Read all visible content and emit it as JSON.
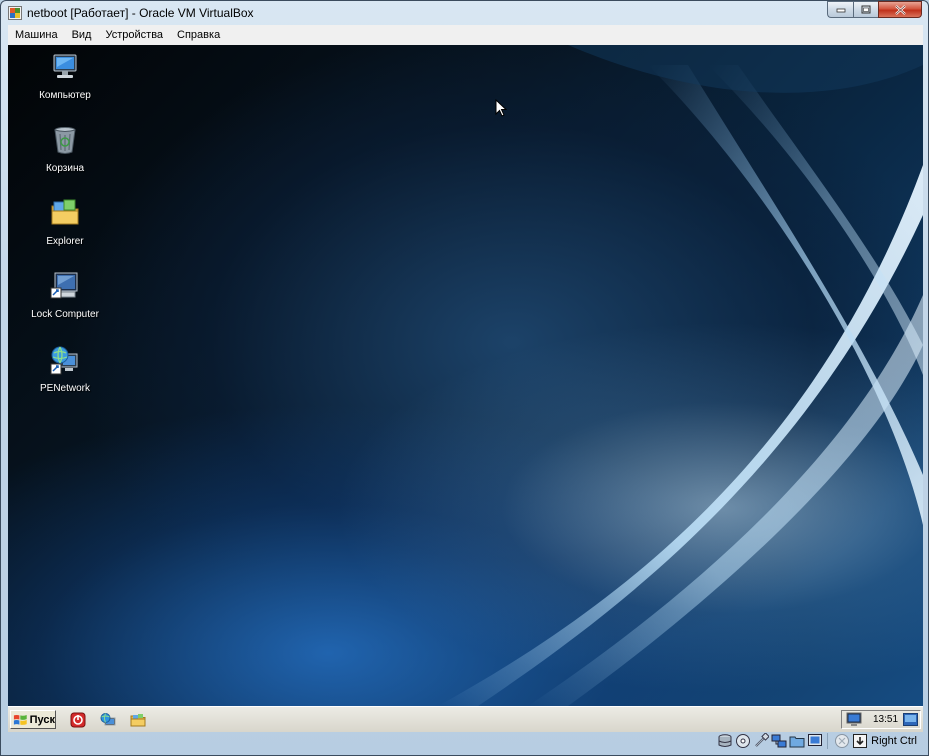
{
  "window": {
    "title": "netboot [Работает] - Oracle VM VirtualBox"
  },
  "menu": {
    "items": [
      "Машина",
      "Вид",
      "Устройства",
      "Справка"
    ]
  },
  "desktop": {
    "icons": [
      {
        "label": "Компьютер",
        "icon": "computer-icon"
      },
      {
        "label": "Корзина",
        "icon": "recycle-bin-icon"
      },
      {
        "label": "Explorer",
        "icon": "explorer-icon"
      },
      {
        "label": "Lock Computer",
        "icon": "lock-computer-icon"
      },
      {
        "label": "PENetwork",
        "icon": "network-icon"
      }
    ]
  },
  "taskbar": {
    "start_label": "Пуск",
    "quick_launch": [
      "antivirus-icon",
      "network-globe-icon",
      "folder-icon"
    ],
    "clock": "13:51"
  },
  "statusbar": {
    "icons": [
      "hard-disk-icon",
      "optical-drive-icon",
      "usb-icon",
      "network-icon",
      "shared-folders-icon",
      "display-icon",
      "mouse-integration-icon",
      "keyboard-capture-icon"
    ],
    "host_key": "Right Ctrl"
  }
}
